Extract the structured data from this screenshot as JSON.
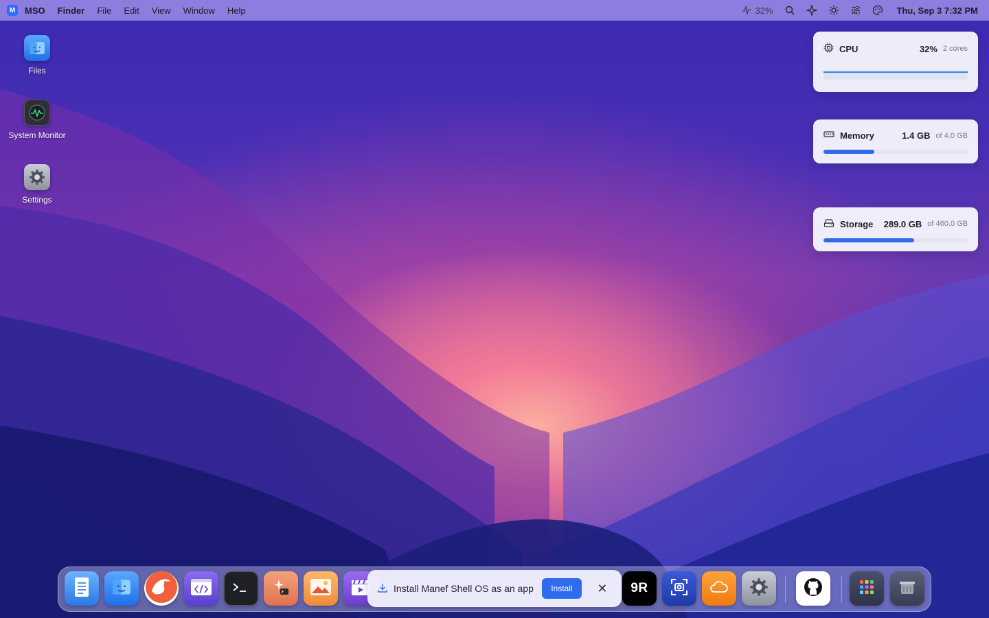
{
  "menubar": {
    "logo": "M",
    "app_name": "MSO",
    "menus": [
      "Finder",
      "File",
      "Edit",
      "View",
      "Window",
      "Help"
    ],
    "cpu_status": "32%",
    "clock": "Thu, Sep 3 7:32 PM"
  },
  "desktop": {
    "icons": [
      {
        "label": "Files",
        "icon": "files-icon"
      },
      {
        "label": "System Monitor",
        "icon": "activity-monitor-icon"
      },
      {
        "label": "Settings",
        "icon": "gear-icon"
      }
    ]
  },
  "widgets": {
    "cpu": {
      "name": "CPU",
      "value": "32%",
      "sub": "2 cores",
      "percent": 32
    },
    "memory": {
      "name": "Memory",
      "value": "1.4 GB",
      "sub": "of 4.0 GB",
      "percent": 35
    },
    "storage": {
      "name": "Storage",
      "value": "289.0 GB",
      "sub": "of 460.0 GB",
      "percent": 63
    }
  },
  "toast": {
    "message": "Install Manef Shell OS as an app",
    "button": "Install",
    "close": "✕"
  },
  "dock": {
    "nine_r_label": "9R"
  },
  "colors": {
    "accent": "#2f6bef",
    "menubar": "#aaa0f0"
  }
}
